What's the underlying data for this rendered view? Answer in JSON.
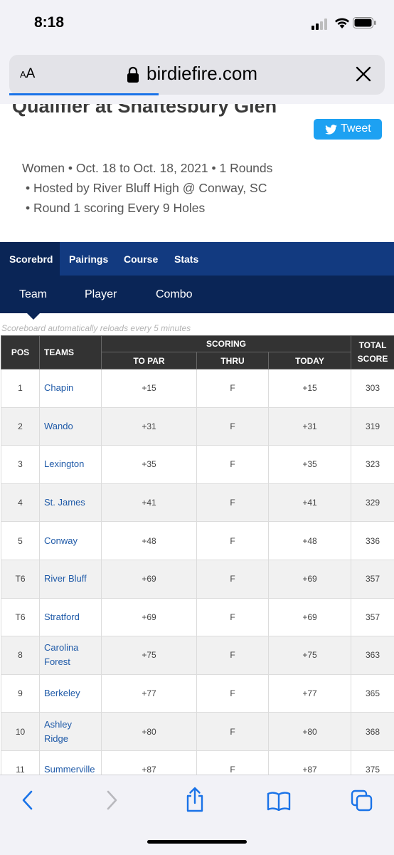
{
  "status": {
    "time": "8:18"
  },
  "browser": {
    "aa_label_small": "A",
    "aa_label": "A",
    "url": "birdiefire.com"
  },
  "page": {
    "cut_title": "Qualifier at Shaftesbury Glen",
    "tweet_label": "Tweet",
    "info": {
      "line1": "Women  •  Oct. 18 to Oct. 18, 2021  •  1 Rounds",
      "line2": "•  Hosted by River Bluff High @ Conway, SC",
      "line3": "•  Round 1 scoring Every 9 Holes"
    },
    "nav_tabs": [
      "Scorebrd",
      "Pairings",
      "Course",
      "Stats"
    ],
    "sub_tabs": [
      "Team",
      "Player",
      "Combo"
    ],
    "reload_note": "Scoreboard automatically reloads every 5 minutes"
  },
  "table": {
    "headers": {
      "pos": "POS",
      "teams": "TEAMS",
      "scoring": "SCORING",
      "to_par": "TO PAR",
      "thru": "THRU",
      "today": "TODAY",
      "total_l1": "TOTAL",
      "total_l2": "SCORE"
    },
    "rows": [
      {
        "pos": "1",
        "team": "Chapin",
        "to_par": "+15",
        "thru": "F",
        "today": "+15",
        "total": "303"
      },
      {
        "pos": "2",
        "team": "Wando",
        "to_par": "+31",
        "thru": "F",
        "today": "+31",
        "total": "319"
      },
      {
        "pos": "3",
        "team": "Lexington",
        "to_par": "+35",
        "thru": "F",
        "today": "+35",
        "total": "323"
      },
      {
        "pos": "4",
        "team": "St. James",
        "to_par": "+41",
        "thru": "F",
        "today": "+41",
        "total": "329"
      },
      {
        "pos": "5",
        "team": "Conway",
        "to_par": "+48",
        "thru": "F",
        "today": "+48",
        "total": "336"
      },
      {
        "pos": "T6",
        "team": "River Bluff",
        "to_par": "+69",
        "thru": "F",
        "today": "+69",
        "total": "357"
      },
      {
        "pos": "T6",
        "team": "Stratford",
        "to_par": "+69",
        "thru": "F",
        "today": "+69",
        "total": "357"
      },
      {
        "pos": "8",
        "team": "Carolina Forest",
        "to_par": "+75",
        "thru": "F",
        "today": "+75",
        "total": "363"
      },
      {
        "pos": "9",
        "team": "Berkeley",
        "to_par": "+77",
        "thru": "F",
        "today": "+77",
        "total": "365"
      },
      {
        "pos": "10",
        "team": "Ashley Ridge",
        "to_par": "+80",
        "thru": "F",
        "today": "+80",
        "total": "368"
      },
      {
        "pos": "11",
        "team": "Summerville",
        "to_par": "+87",
        "thru": "F",
        "today": "+87",
        "total": "375"
      }
    ]
  },
  "toolbar_icons": [
    "back-icon",
    "forward-icon",
    "share-icon",
    "bookmarks-icon",
    "tabs-icon"
  ],
  "colors": {
    "nav_bg": "#123a80",
    "nav_dark": "#0a2556",
    "link": "#1f5aa8",
    "tweet": "#1da1f2",
    "ios_blue": "#1a73e8"
  }
}
